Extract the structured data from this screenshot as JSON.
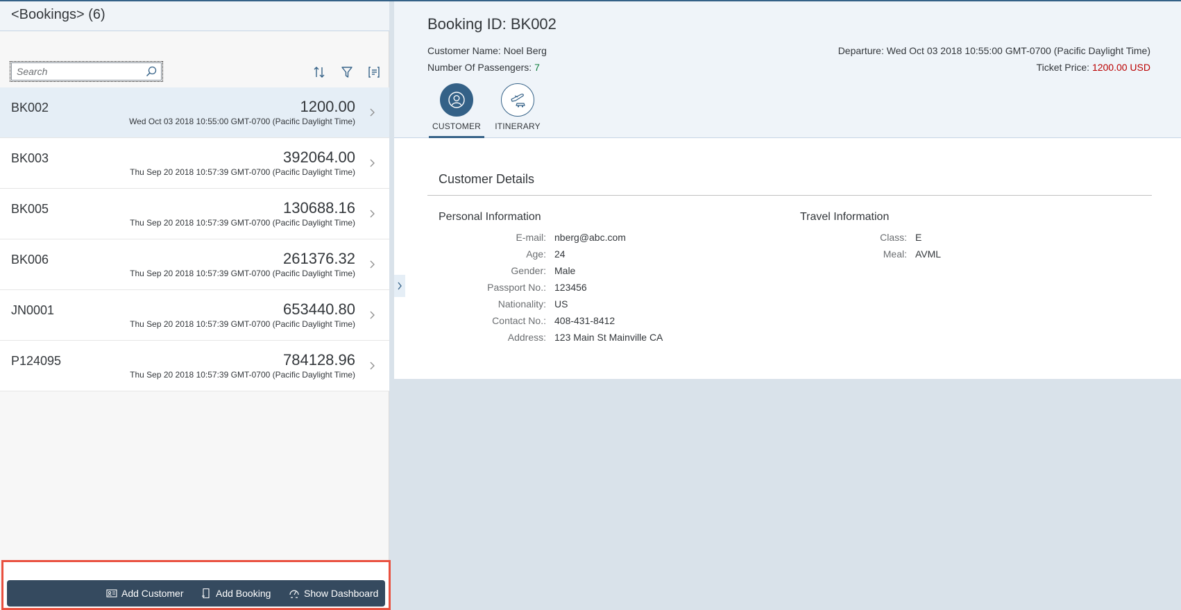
{
  "master": {
    "title": "<Bookings> (6)",
    "search": {
      "placeholder": "Search",
      "value": ""
    },
    "items": [
      {
        "id": "BK002",
        "amount": "1200.00",
        "date": "Wed Oct 03 2018 10:55:00 GMT-0700 (Pacific Daylight Time)",
        "selected": true
      },
      {
        "id": "BK003",
        "amount": "392064.00",
        "date": "Thu Sep 20 2018 10:57:39 GMT-0700 (Pacific Daylight Time)"
      },
      {
        "id": "BK005",
        "amount": "130688.16",
        "date": "Thu Sep 20 2018 10:57:39 GMT-0700 (Pacific Daylight Time)"
      },
      {
        "id": "BK006",
        "amount": "261376.32",
        "date": "Thu Sep 20 2018 10:57:39 GMT-0700 (Pacific Daylight Time)"
      },
      {
        "id": "JN0001",
        "amount": "653440.80",
        "date": "Thu Sep 20 2018 10:57:39 GMT-0700 (Pacific Daylight Time)"
      },
      {
        "id": "P124095",
        "amount": "784128.96",
        "date": "Thu Sep 20 2018 10:57:39 GMT-0700 (Pacific Daylight Time)"
      }
    ],
    "toolbar_icons": [
      "sort-icon",
      "filter-icon",
      "group-icon"
    ]
  },
  "footer": {
    "add_customer": "Add Customer",
    "add_booking": "Add Booking",
    "show_dashboard": "Show Dashboard"
  },
  "detail": {
    "title": "Booking ID: BK002",
    "customer_name_label": "Customer Name:",
    "customer_name": "Noel Berg",
    "passengers_label": "Number Of Passengers:",
    "passengers": "7",
    "departure_label": "Departure:",
    "departure": "Wed Oct 03 2018 10:55:00 GMT-0700 (Pacific Daylight Time)",
    "price_label": "Ticket Price:",
    "price": "1200.00 USD",
    "tabs": [
      {
        "label": "CUSTOMER",
        "icon": "customer-icon",
        "active": true
      },
      {
        "label": "ITINERARY",
        "icon": "itinerary-icon",
        "active": false
      }
    ],
    "section_title": "Customer Details",
    "personal": {
      "title": "Personal Information",
      "fields": [
        {
          "label": "E-mail:",
          "value": "nberg@abc.com"
        },
        {
          "label": "Age:",
          "value": "24"
        },
        {
          "label": "Gender:",
          "value": "Male"
        },
        {
          "label": "Passport No.:",
          "value": "123456"
        },
        {
          "label": "Nationality:",
          "value": "US"
        },
        {
          "label": "Contact No.:",
          "value": "408-431-8412"
        },
        {
          "label": "Address:",
          "value": "123 Main St Mainville CA"
        }
      ]
    },
    "travel": {
      "title": "Travel Information",
      "fields": [
        {
          "label": "Class:",
          "value": "E"
        },
        {
          "label": "Meal:",
          "value": "AVML"
        }
      ]
    }
  },
  "colors": {
    "accent": "#346187",
    "price_red": "#bb0000",
    "passengers_green": "#107e3e",
    "footer_bg": "#354a5f",
    "highlight_border": "#e9503f"
  }
}
